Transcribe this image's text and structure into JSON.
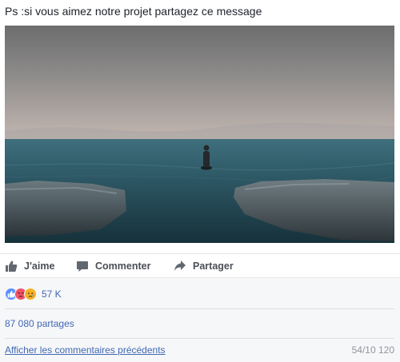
{
  "post": {
    "text": "Ps :si vous aimez notre projet partagez ce message"
  },
  "actions": {
    "like_label": "J'aime",
    "comment_label": "Commenter",
    "share_label": "Partager"
  },
  "reactions": {
    "types": [
      "like-icon",
      "angry-icon",
      "sad-icon"
    ],
    "count": "57 K"
  },
  "shares": {
    "text": "87 080 partages"
  },
  "comments": {
    "previous_link": "Afficher les commentaires précédents",
    "count": "54/10 120"
  },
  "colors": {
    "link": "#4267b2",
    "action_text": "#4b4f56",
    "like_blue": "#5890ff",
    "angry": "#f25268",
    "sad": "#f7b125"
  }
}
